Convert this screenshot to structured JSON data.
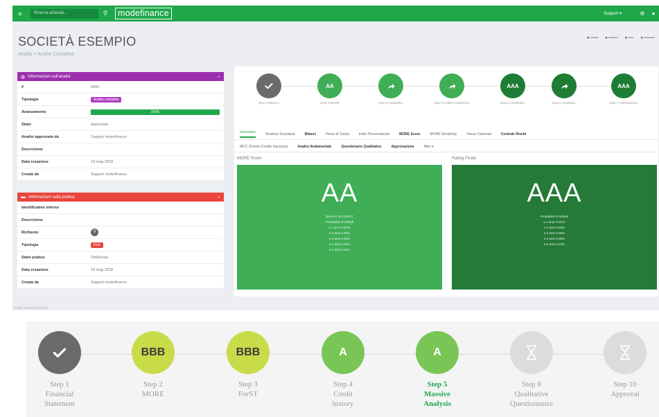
{
  "topbar": {
    "menu_icon": "menu-icon",
    "search_placeholder": "Ricerca azienda...",
    "logo": "modefinance",
    "user": "Support ▾"
  },
  "header": {
    "company": "SOCIETÀ ESEMPIO",
    "subtitle": "Analisi > Analisi Completa"
  },
  "panel_info": {
    "title": "Informazioni sull'analisi",
    "rows": [
      {
        "k": "#",
        "v": "0000"
      },
      {
        "k": "Tipologia",
        "v": "Analisi completa"
      },
      {
        "k": "Avanzamento",
        "v": "100%"
      },
      {
        "k": "Stato",
        "v": "Approvata"
      },
      {
        "k": "Analisi approvata da",
        "v": "Support modefinance"
      },
      {
        "k": "Descrizione",
        "v": ""
      },
      {
        "k": "Data creazione",
        "v": "18 mag 2018"
      },
      {
        "k": "Creata da",
        "v": "Support modefinance"
      }
    ]
  },
  "panel_practice": {
    "title": "Informazioni sulla pratica",
    "rows": [
      {
        "k": "Identificativo interno",
        "v": ""
      },
      {
        "k": "Descrizione",
        "v": ""
      },
      {
        "k": "Richieste",
        "v": "0"
      },
      {
        "k": "Tipologia",
        "v": "Fido"
      },
      {
        "k": "Stato pratica",
        "v": "Deliberata"
      },
      {
        "k": "Data creazione",
        "v": "18 mag 2018"
      },
      {
        "k": "Creata da",
        "v": "Support modefinance"
      }
    ]
  },
  "mini_steps": [
    {
      "grade": "",
      "label": "Step 1 Bilancio",
      "color": "#6b6b6b"
    },
    {
      "grade": "AA",
      "label": "Step 2 MORE",
      "color": "#3fae56"
    },
    {
      "grade": "",
      "label": "Step 3 Qualitativo",
      "color": "#3fae56"
    },
    {
      "grade": "",
      "label": "Step 4 Analisi Andamento",
      "color": "#3fae56"
    },
    {
      "grade": "AAA",
      "label": "Step 5 Qualitativo",
      "color": "#1e7d35"
    },
    {
      "grade": "",
      "label": "Step 6 Qualitativo",
      "color": "#1e7d35"
    },
    {
      "grade": "AAA",
      "label": "Step 7 Approvazione",
      "color": "#1e7d35"
    }
  ],
  "tabs_row1": [
    "Sommario",
    "Struttura Societaria",
    "Bilanci",
    "Flussi di Cassa",
    "Indici Personalizzati",
    "MORE Score",
    "MORE Sensitivity",
    "Visure Camerali",
    "Centrale Rischi"
  ],
  "tabs_row2": [
    "MCC (Fondo Credito Garanzia)",
    "Analisi Andamentale",
    "Questionario Qualitativo",
    "Approvazione",
    "Altro ▾"
  ],
  "score_more": {
    "head": "MORE Score",
    "grade": "AA",
    "lines": [
      "Bilancio 31/12/2017",
      "Probabilità di default",
      "a 1 anno 0,03%",
      "a 2 anni 0,06%",
      "a 3 anni 0,10%",
      "a 4 anni 0,16%",
      "a 5 anni 0,24%"
    ],
    "color": "#3fae56"
  },
  "score_final": {
    "head": "Rating Finale",
    "grade": "AAA",
    "lines": [
      "Probabilità di default",
      "a 1 anno 0,01%",
      "a 2 anni 0,03%",
      "a 3 anni 0,06%",
      "a 4 anni 0,09%",
      "a 5 anni 0,13%"
    ],
    "color": "#247a36"
  },
  "footnote": "Analisi Estesa di Bilancio",
  "stepper": [
    {
      "grade": "",
      "line1": "Step 1",
      "line2": "Financial",
      "line3": "Statement",
      "color": "#6a6a6a",
      "icon": "check-icon",
      "active": false
    },
    {
      "grade": "BBB",
      "line1": "Step 2",
      "line2": "MORE",
      "line3": "",
      "color": "#c8dc4a",
      "icon": "",
      "active": false
    },
    {
      "grade": "BBB",
      "line1": "Step 3",
      "line2": "ForST",
      "line3": "",
      "color": "#c8dc4a",
      "icon": "",
      "active": false
    },
    {
      "grade": "A",
      "line1": "Step 4",
      "line2": "Credit",
      "line3": "history",
      "color": "#79c656",
      "icon": "",
      "active": false
    },
    {
      "grade": "A",
      "line1": "Step 5",
      "line2": "Massive",
      "line3": "Analysis",
      "color": "#79c656",
      "icon": "",
      "active": true
    },
    {
      "grade": "",
      "line1": "Step 8",
      "line2": "Qualitative",
      "line3": "Questionnaire",
      "color": "#dcdcdc",
      "icon": "hourglass-icon",
      "active": false
    },
    {
      "grade": "",
      "line1": "Step 10",
      "line2": "Approval",
      "line3": "",
      "color": "#dcdcdc",
      "icon": "hourglass-icon",
      "active": false
    }
  ]
}
